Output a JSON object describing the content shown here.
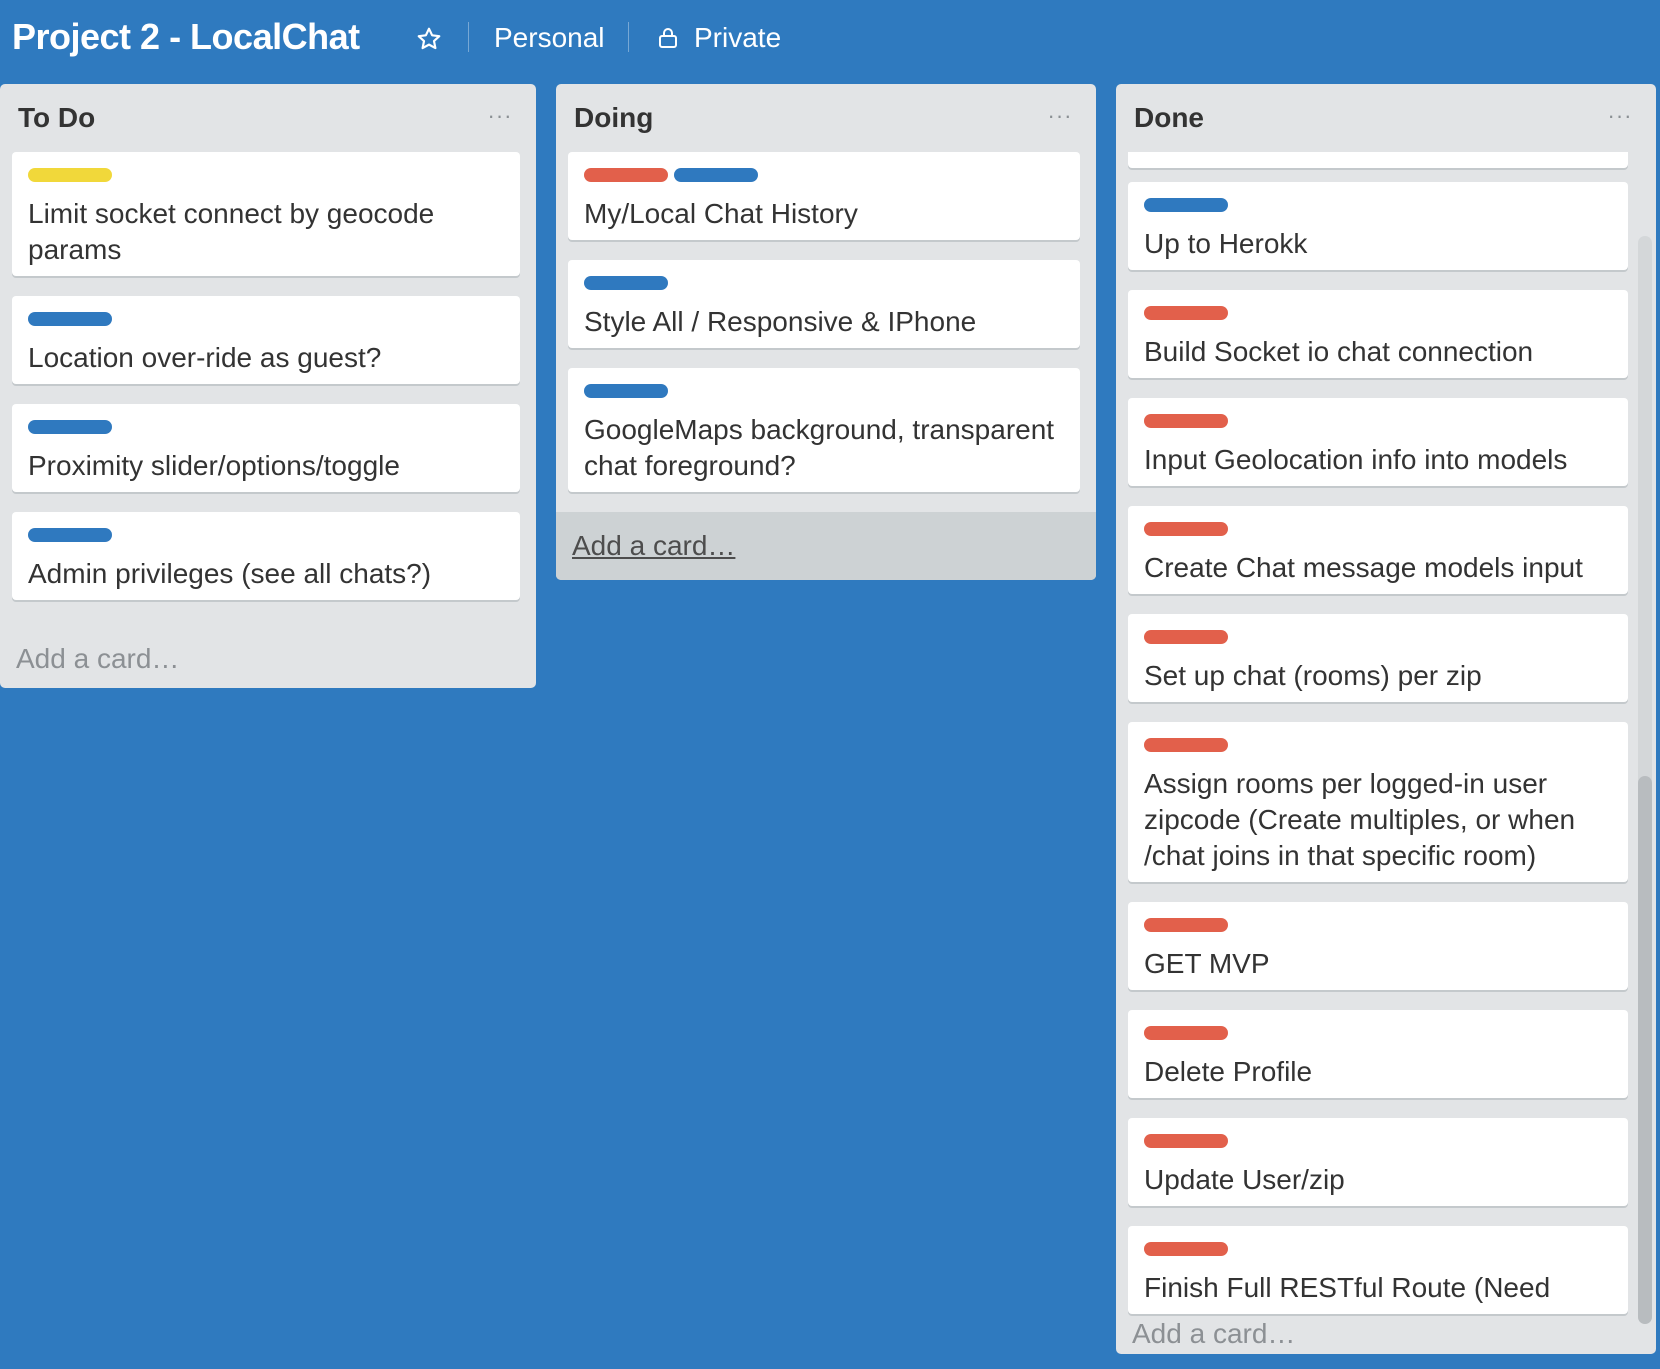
{
  "header": {
    "title": "Project 2 - LocalChat",
    "star_icon": "star-icon",
    "team_label": "Personal",
    "visibility_label": "Private",
    "lock_icon": "lock-icon"
  },
  "colors": {
    "background": "#2f7abf",
    "list_bg": "#e2e4e6",
    "label_blue": "#2f79bf",
    "label_red": "#e2604b",
    "label_yellow": "#f1d83a"
  },
  "lists": [
    {
      "title": "To Do",
      "menu": "···",
      "cards": [
        {
          "labels": [
            "yellow"
          ],
          "text": "Limit socket connect by geocode params"
        },
        {
          "labels": [
            "blue"
          ],
          "text": "Location over-ride as guest?"
        },
        {
          "labels": [
            "blue"
          ],
          "text": "Proximity slider/options/toggle"
        },
        {
          "labels": [
            "blue"
          ],
          "text": "Admin privileges (see all chats?)"
        }
      ],
      "add_card": "Add a card…"
    },
    {
      "title": "Doing",
      "menu": "···",
      "cards": [
        {
          "labels": [
            "red",
            "blue"
          ],
          "text": "My/Local Chat History"
        },
        {
          "labels": [
            "blue"
          ],
          "text": "Style All / Responsive & IPhone"
        },
        {
          "labels": [
            "blue"
          ],
          "text": "GoogleMaps background, transparent chat foreground?"
        }
      ],
      "add_card": "Add a card…"
    },
    {
      "title": "Done",
      "menu": "···",
      "cards": [
        {
          "labels": [
            "blue"
          ],
          "text": "Up to Herokk"
        },
        {
          "labels": [
            "red"
          ],
          "text": "Build Socket io chat connection"
        },
        {
          "labels": [
            "red"
          ],
          "text": "Input Geolocation info into models"
        },
        {
          "labels": [
            "red"
          ],
          "text": "Create Chat message models input"
        },
        {
          "labels": [
            "red"
          ],
          "text": "Set up chat (rooms) per zip"
        },
        {
          "labels": [
            "red"
          ],
          "text": "Assign rooms per logged-in user zipcode (Create multiples, or when /chat joins in that specific room)"
        },
        {
          "labels": [
            "red"
          ],
          "text": "GET MVP"
        },
        {
          "labels": [
            "red"
          ],
          "text": "Delete Profile"
        },
        {
          "labels": [
            "red"
          ],
          "text": "Update User/zip"
        },
        {
          "labels": [
            "red"
          ],
          "text": "Finish Full RESTful Route (Need"
        }
      ],
      "add_card": "Add a card…"
    }
  ]
}
